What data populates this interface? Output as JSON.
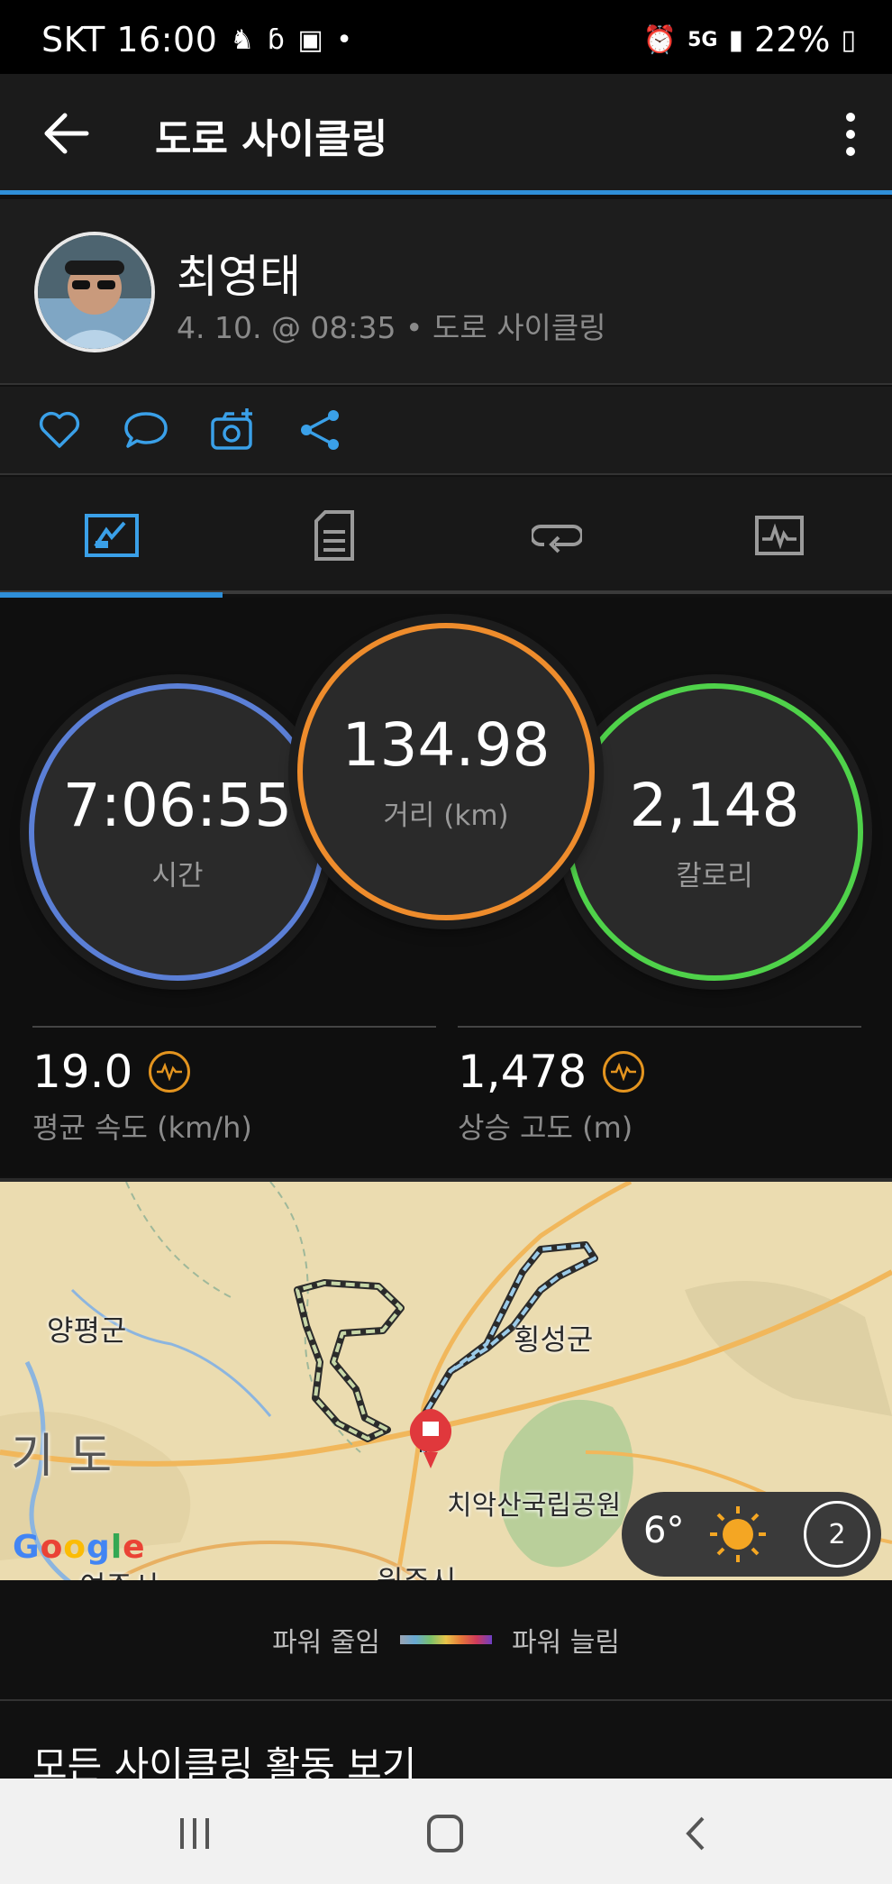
{
  "status_bar": {
    "carrier_time": "SKT 16:00",
    "battery": "22%",
    "network": "5G"
  },
  "appbar": {
    "title": "도로 사이클링"
  },
  "profile": {
    "name": "최영태",
    "subtitle": "4. 10. @ 08:35 • 도로 사이클링"
  },
  "actions": [
    "like-icon",
    "comment-icon",
    "add-photo-icon",
    "share-icon"
  ],
  "tabs": [
    {
      "icon": "overview-icon",
      "selected": true
    },
    {
      "icon": "details-icon",
      "selected": false
    },
    {
      "icon": "laps-icon",
      "selected": false
    },
    {
      "icon": "charts-icon",
      "selected": false
    }
  ],
  "stats": {
    "time": {
      "value": "7:06:55",
      "label": "시간",
      "color": "#5b7fd6"
    },
    "distance": {
      "value": "134.98",
      "label": "거리 (km)",
      "color": "#ee8c2c"
    },
    "calories": {
      "value": "2,148",
      "label": "칼로리",
      "color": "#4fd24a"
    },
    "avg_speed": {
      "value": "19.0",
      "label": "평균 속도 (km/h)"
    },
    "ascent": {
      "value": "1,478",
      "label": "상승 고도 (m)"
    }
  },
  "map": {
    "labels": {
      "yangpyeong": "양평군",
      "hoengseong": "횡성군",
      "gido": "기 도",
      "chiaksan": "치악산국립공원",
      "wonju": "원주시",
      "yeoju": "여주시"
    },
    "attribution": "Google",
    "weather": {
      "temp": "6°",
      "wind": "2"
    }
  },
  "legend": {
    "left": "파워 줄임",
    "right": "파워 늘림"
  },
  "more_link": "모든 사이클링 활동 보기"
}
